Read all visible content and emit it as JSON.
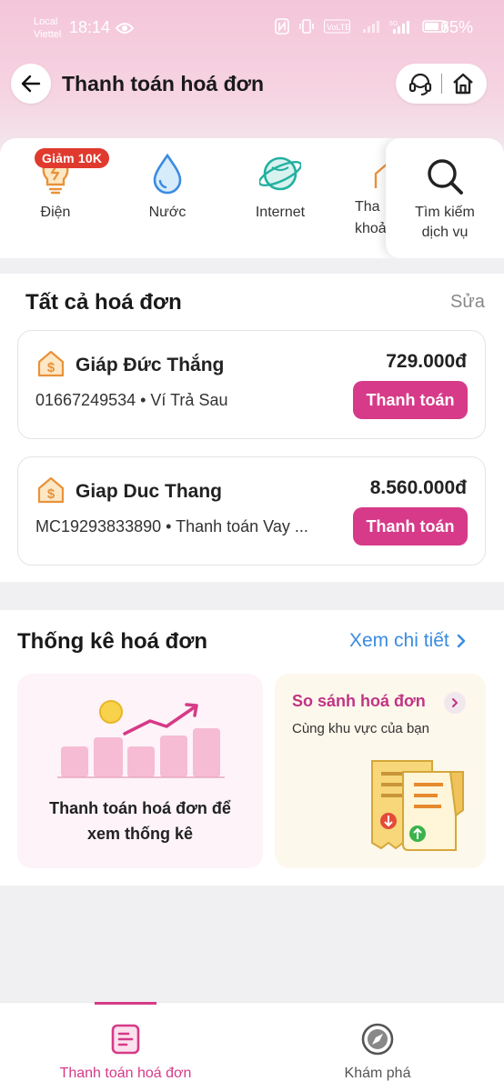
{
  "status_bar": {
    "carrier_line1": "Local",
    "carrier_line2": "Viettel",
    "time": "18:14",
    "battery": "65%"
  },
  "header": {
    "title": "Thanh toán hoá đơn"
  },
  "services": {
    "items": [
      {
        "label": "Điện",
        "icon": "lightbulb-icon",
        "badge": "Giảm 10K"
      },
      {
        "label": "Nước",
        "icon": "water-drop-icon"
      },
      {
        "label": "Internet",
        "icon": "globe-icon"
      },
      {
        "label": "Thanh toán khoản vay",
        "visible_label": "Tha\nkhoả",
        "icon": "house-icon"
      }
    ],
    "search": {
      "line1": "Tìm kiếm",
      "line2": "dịch vụ",
      "icon": "search-icon"
    }
  },
  "bills": {
    "title": "Tất cả hoá đơn",
    "edit_label": "Sửa",
    "items": [
      {
        "name": "Giáp Đức Thắng",
        "amount": "729.000đ",
        "subtitle": "01667249534 • Ví Trả Sau",
        "pay_label": "Thanh toán"
      },
      {
        "name": "Giap Duc Thang",
        "amount": "8.560.000đ",
        "subtitle": "MC19293833890 • Thanh toán Vay ...",
        "pay_label": "Thanh toán"
      }
    ]
  },
  "stats": {
    "title": "Thống kê hoá đơn",
    "detail_label": "Xem chi tiết",
    "left_card": {
      "line1": "Thanh toán hoá đơn để",
      "line2": "xem thống kê"
    },
    "right_card": {
      "title": "So sánh hoá đơn",
      "subtitle": "Cùng khu vực của bạn"
    }
  },
  "bottom_nav": {
    "items": [
      {
        "label": "Thanh toán hoá đơn",
        "active": true
      },
      {
        "label": "Khám phá",
        "active": false
      }
    ]
  },
  "colors": {
    "accent": "#d63a88",
    "link": "#3a8be0",
    "badge": "#e03a2f"
  }
}
